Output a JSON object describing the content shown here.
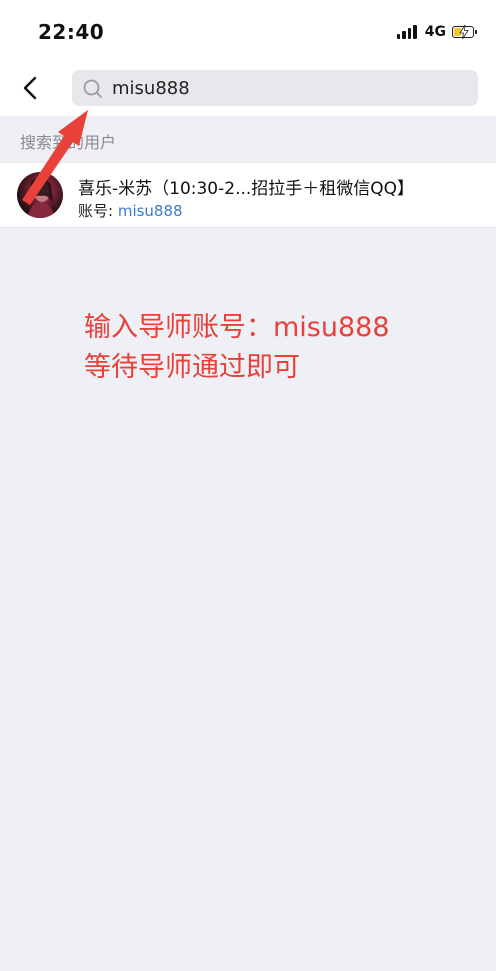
{
  "status_bar": {
    "time": "22:40",
    "network": "4G",
    "battery_level": 0.35,
    "battery_color": "#f4c92b"
  },
  "nav": {
    "back_icon": "chevron-left-icon"
  },
  "search": {
    "value": "misu888",
    "icon": "search-icon"
  },
  "results": {
    "section_title": "搜索到的用户",
    "users": [
      {
        "name": "喜乐-米苏（10:30-2...招拉手＋租微信QQ】",
        "account_label": "账号: ",
        "account_value": "misu888"
      }
    ]
  },
  "annotation": {
    "line1": "输入导师账号：misu888",
    "line2": "等待导师通过即可",
    "color": "#e8413a"
  },
  "colors": {
    "accent_link": "#3a7bc8",
    "background": "#efeff6"
  }
}
